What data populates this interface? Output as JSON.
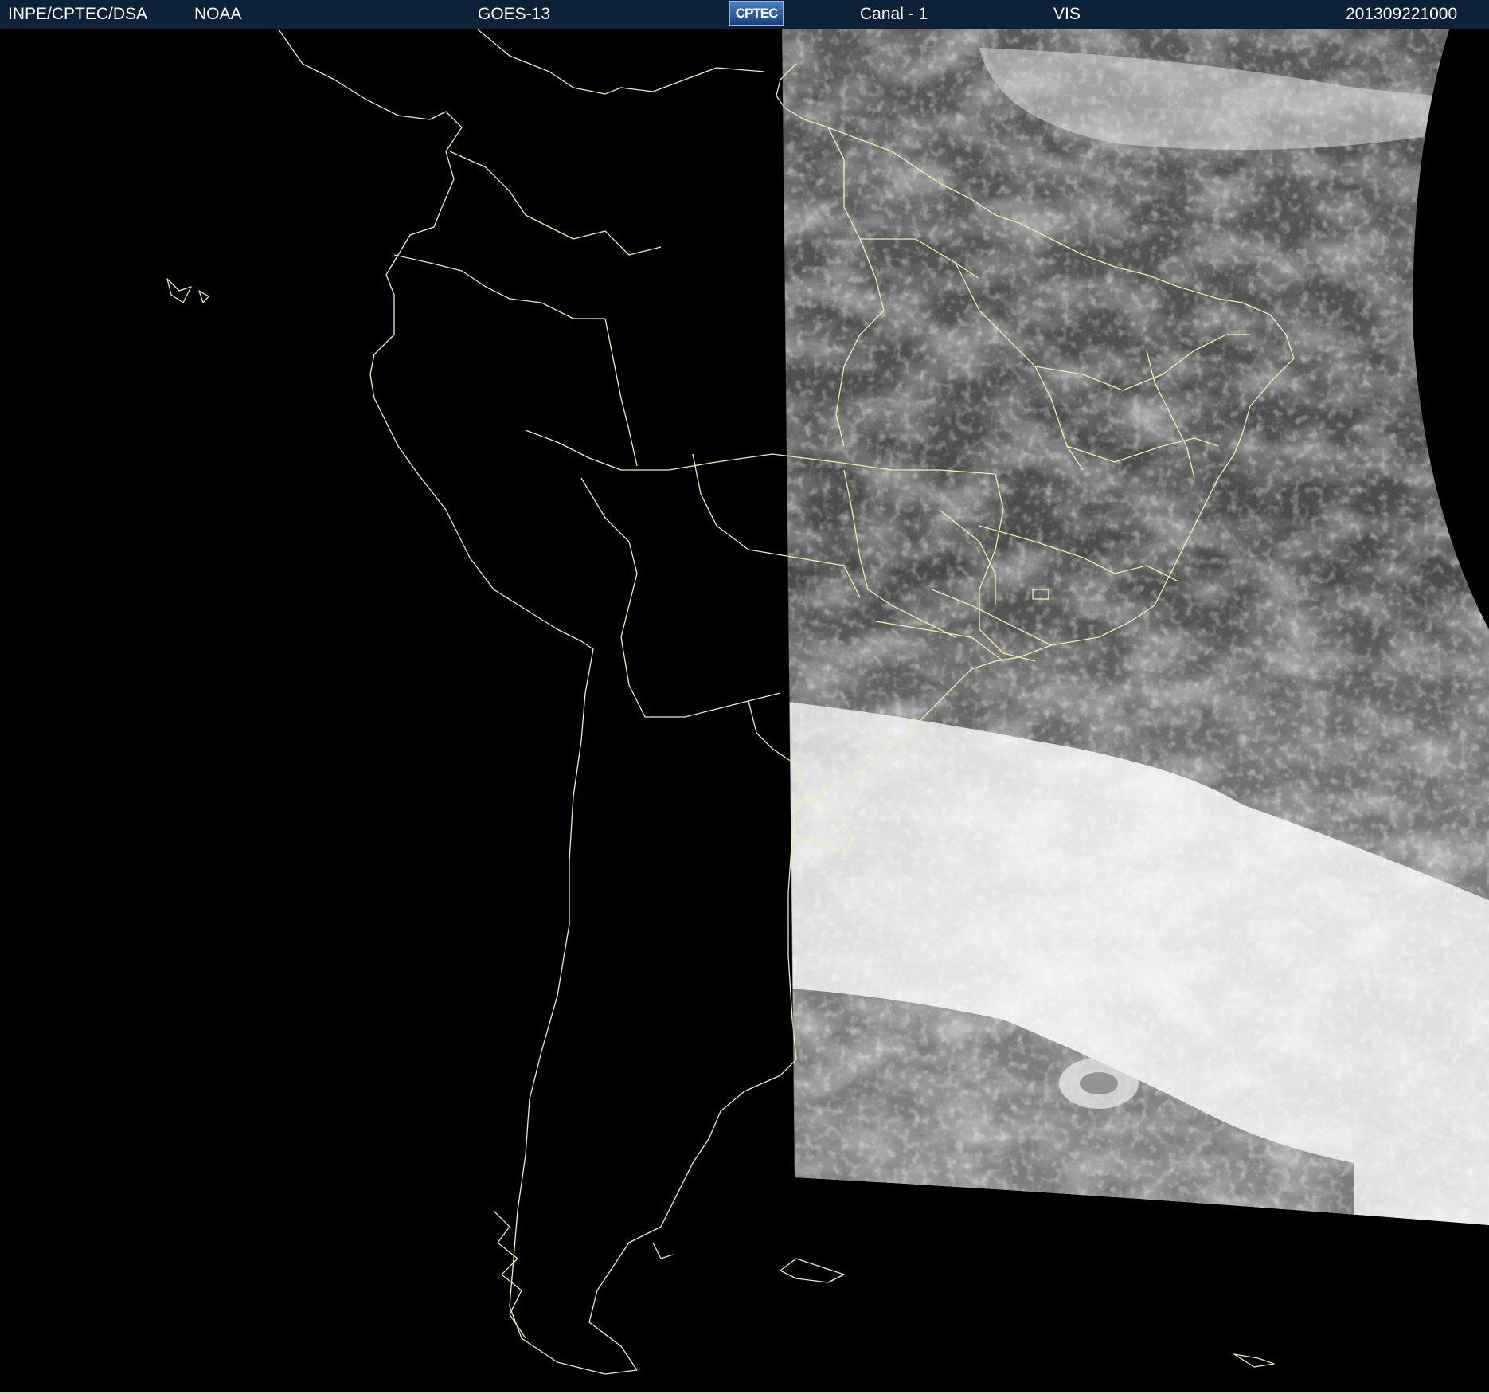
{
  "header": {
    "agency": "INPE/CPTEC/DSA",
    "provider": "NOAA",
    "satellite": "GOES-13",
    "logo_text": "CPTEC",
    "channel": "Canal - 1",
    "band": "VIS",
    "timestamp": "201309221000"
  },
  "colors": {
    "header_bg": "#0d2238",
    "border_lines": "#f2f0b0",
    "ocean": "#000000",
    "cloud_bright": "#f0f0f0",
    "land_gray": "#555555"
  }
}
